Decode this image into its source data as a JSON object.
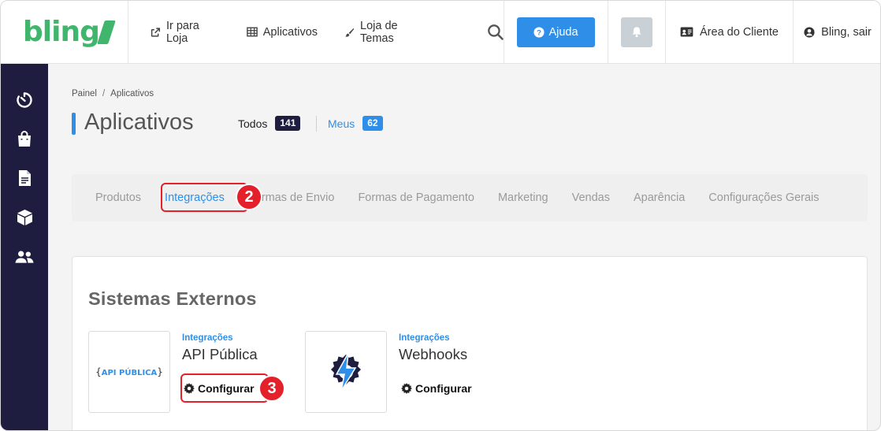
{
  "header": {
    "logo": "bling",
    "nav": [
      {
        "label": "Ir para Loja",
        "icon": "external-link-icon"
      },
      {
        "label": "Aplicativos",
        "icon": "grid-icon"
      },
      {
        "label": "Loja de Temas",
        "icon": "brush-icon"
      }
    ],
    "help_label": "Ajuda",
    "client_area_label": "Área do Cliente",
    "user_label": "Bling, sair"
  },
  "sidebar": {
    "icons": [
      "timer-icon",
      "shopping-bag-icon",
      "document-icon",
      "box-icon",
      "users-icon"
    ]
  },
  "breadcrumb": {
    "root": "Painel",
    "separator": "/",
    "current": "Aplicativos"
  },
  "page": {
    "title": "Aplicativos",
    "counts": [
      {
        "label": "Todos",
        "value": "141"
      },
      {
        "label": "Meus",
        "value": "62"
      }
    ]
  },
  "tabs": [
    {
      "label": "Produtos",
      "active": false
    },
    {
      "label": "Integrações",
      "active": true
    },
    {
      "label": "Formas de Envio",
      "active": false
    },
    {
      "label": "Formas de Pagamento",
      "active": false
    },
    {
      "label": "Marketing",
      "active": false
    },
    {
      "label": "Vendas",
      "active": false
    },
    {
      "label": "Aparência",
      "active": false
    },
    {
      "label": "Configurações Gerais",
      "active": false
    }
  ],
  "section": {
    "title": "Sistemas Externos",
    "apps": [
      {
        "category": "Integrações",
        "name": "API Pública",
        "logo_text": "API PÚBLICA",
        "configure_label": "Configurar"
      },
      {
        "category": "Integrações",
        "name": "Webhooks",
        "configure_label": "Configurar"
      }
    ]
  },
  "annotations": {
    "step_tabs": "2",
    "step_configure": "3"
  },
  "colors": {
    "brand_green": "#3fb66b",
    "accent_blue": "#2f8fe8",
    "sidebar_dark": "#1e1d40",
    "highlight_red": "#e4202a"
  }
}
